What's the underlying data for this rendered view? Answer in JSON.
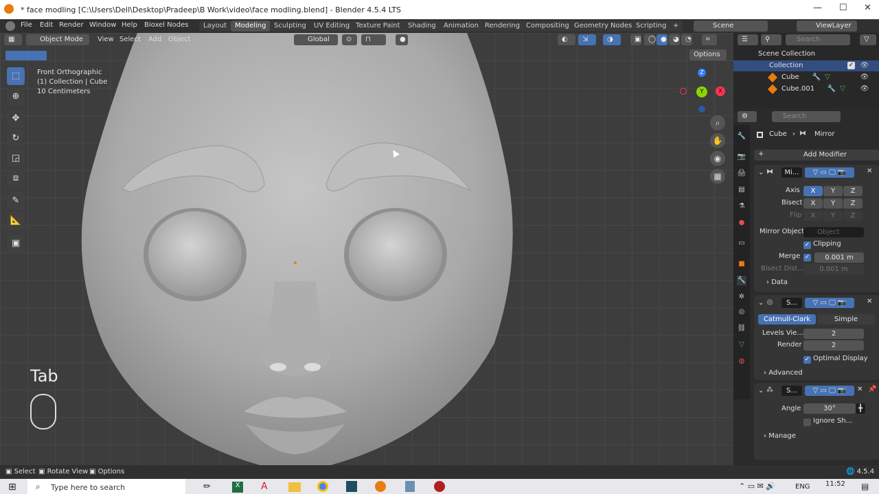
{
  "window": {
    "title": "* face modling [C:\\Users\\Dell\\Desktop\\Pradeep\\B Work\\video\\face modling.blend] - Blender 4.5.4 LTS"
  },
  "menubar": {
    "items": [
      "File",
      "Edit",
      "Render",
      "Window",
      "Help",
      "Bioxel Nodes"
    ]
  },
  "workspaces": [
    "Layout",
    "Modeling",
    "Sculpting",
    "UV Editing",
    "Texture Paint",
    "Shading",
    "Animation",
    "Rendering",
    "Compositing",
    "Geometry Nodes",
    "Scripting"
  ],
  "active_workspace": "Modeling",
  "scene": "Scene",
  "view_layer": "ViewLayer",
  "viewport": {
    "mode": "Object Mode",
    "menus": [
      "View",
      "Select",
      "Add",
      "Object"
    ],
    "transform": "Global",
    "options_label": "Options",
    "info": {
      "view": "Front Orthographic",
      "collection": "(1) Collection | Cube",
      "scale": "10 Centimeters"
    },
    "key_overlay": "Tab",
    "gizmo": {
      "z": "Z",
      "y": "Y",
      "x": "X"
    }
  },
  "outliner": {
    "search_placeholder": "Search",
    "root": "Scene Collection",
    "collection": "Collection",
    "items": [
      "Cube",
      "Cube.001"
    ]
  },
  "properties": {
    "search_placeholder": "Search",
    "breadcrumb_object": "Cube",
    "breadcrumb_modifier": "Mirror",
    "add_modifier": "Add Modifier",
    "mirror": {
      "name": "Mi...",
      "axis_label": "Axis",
      "bisect_label": "Bisect",
      "flip_label": "Flip",
      "axes": [
        "X",
        "Y",
        "Z"
      ],
      "mirror_object_label": "Mirror Object",
      "mirror_object_placeholder": "Object",
      "clipping_label": "Clipping",
      "merge_label": "Merge",
      "merge_value": "0.001 m",
      "bisect_dist_label": "Bisect Dist...",
      "bisect_dist_value": "0.001 m",
      "data_label": "Data"
    },
    "subsurf": {
      "name": "S...",
      "catmull": "Catmull-Clark",
      "simple": "Simple",
      "levels_label": "Levels Vie...",
      "levels_value": "2",
      "render_label": "Render",
      "render_value": "2",
      "optimal_label": "Optimal Display",
      "advanced_label": "Advanced"
    },
    "smooth": {
      "name": "S...",
      "angle_label": "Angle",
      "angle_value": "30°",
      "ignore_label": "Ignore Sh...",
      "manage_label": "Manage"
    }
  },
  "statusbar": {
    "select": "Select",
    "rotate": "Rotate View",
    "options": "Options",
    "version": "4.5.4"
  },
  "taskbar": {
    "search_placeholder": "Type here to search",
    "lang": "ENG",
    "time": "11:52"
  }
}
